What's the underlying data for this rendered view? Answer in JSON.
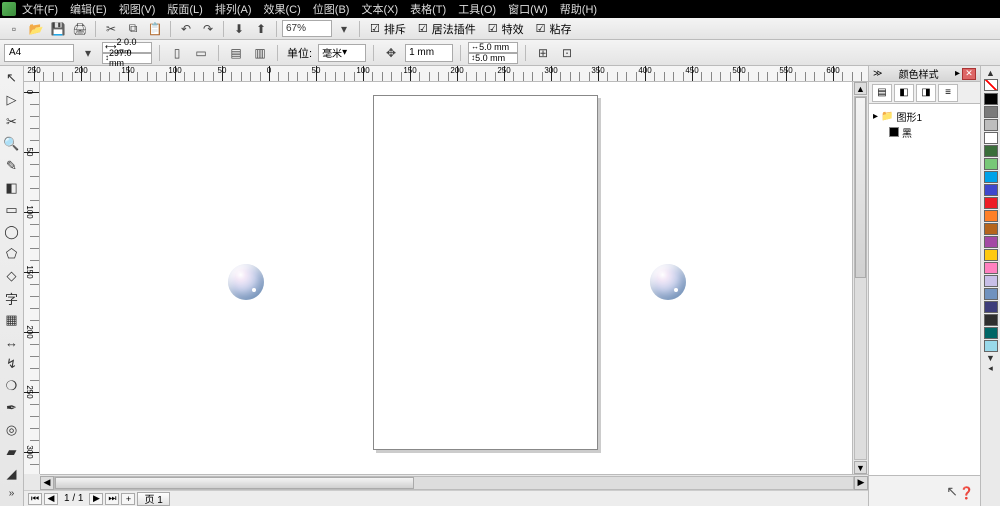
{
  "menubar": {
    "items": [
      "文件(F)",
      "编辑(E)",
      "视图(V)",
      "版面(L)",
      "排列(A)",
      "效果(C)",
      "位图(B)",
      "文本(X)",
      "表格(T)",
      "工具(O)",
      "窗口(W)",
      "帮助(H)"
    ]
  },
  "std_toolbar": {
    "zoom": "67%",
    "snap_items": [
      "排斥",
      "居法插件",
      "特效",
      "粘存"
    ]
  },
  "prop_bar": {
    "page_preset": "A4",
    "page_w": "2 0.0 mm",
    "page_h": "297.0 mm",
    "units_label": "单位:",
    "units_value": "毫米",
    "nudge": "1 mm",
    "dup_x": "5.0 mm",
    "dup_y": "5.0 mm"
  },
  "ruler_h_labels": [
    "250",
    "200",
    "150",
    "100",
    "50",
    "0",
    "50",
    "100",
    "150",
    "200",
    "250",
    "300",
    "350",
    "400",
    "450",
    "500",
    "550",
    "600"
  ],
  "ruler_v_labels": [
    "0",
    "50",
    "100",
    "150",
    "200",
    "250",
    "300"
  ],
  "page_nav": {
    "counter": "1 / 1",
    "tab": "页 1"
  },
  "dock": {
    "title": "颜色样式",
    "folder": "图形1",
    "item": "黑"
  },
  "palette": [
    "#000000",
    "#7b7b7b",
    "#bdbdbd",
    "#ffffff",
    "#3a6e3a",
    "#78c878",
    "#00a2e8",
    "#3f48cc",
    "#ed1c24",
    "#ff7f27",
    "#b5651d",
    "#a349a4",
    "#ffc90e",
    "#ff80c0",
    "#c8bfe7",
    "#7092be",
    "#3d3d7a",
    "#2e2e2e",
    "#006666",
    "#99d9ea"
  ]
}
